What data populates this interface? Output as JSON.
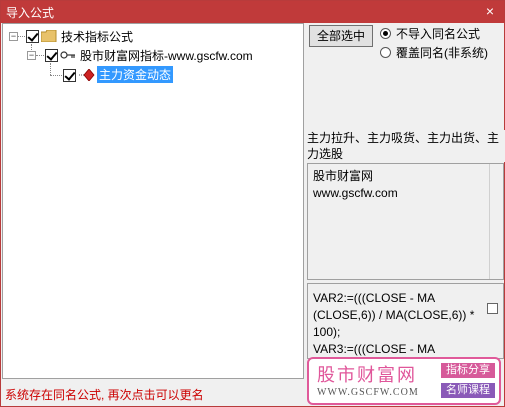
{
  "window": {
    "title": "导入公式",
    "close_glyph": "×"
  },
  "tree": {
    "root": {
      "label": "技术指标公式",
      "expander": "−"
    },
    "child": {
      "label": "股市财富网指标-www.gscfw.com",
      "expander": "−"
    },
    "leaf": {
      "label": "主力资金动态"
    }
  },
  "options": {
    "select_all_label": "全部选中",
    "radio_skip_label": "不导入同名公式",
    "radio_overwrite_label": "覆盖同名(非系统)"
  },
  "description_text": "主力拉升、主力吸货、主力出货、主力选股",
  "source_panel": {
    "text": "股市财富网\nwww.gscfw.com"
  },
  "code_panel": {
    "text": "VAR2:=(((CLOSE - MA\n(CLOSE,6)) / MA(CLOSE,6)) *\n100);\nVAR3:=(((CLOSE - MA"
  },
  "status_text": "系统存在同名公式, 再次点击可以更名",
  "watermark": {
    "brand": "股市财富网",
    "url": "WWW.GSCFW.COM",
    "tag_a": "指标分享",
    "tag_b": "名师课程"
  },
  "colors": {
    "title_bar": "#c03a3a",
    "selection": "#3399ff",
    "status": "#cc0000",
    "watermark_border": "#e05a9a"
  }
}
